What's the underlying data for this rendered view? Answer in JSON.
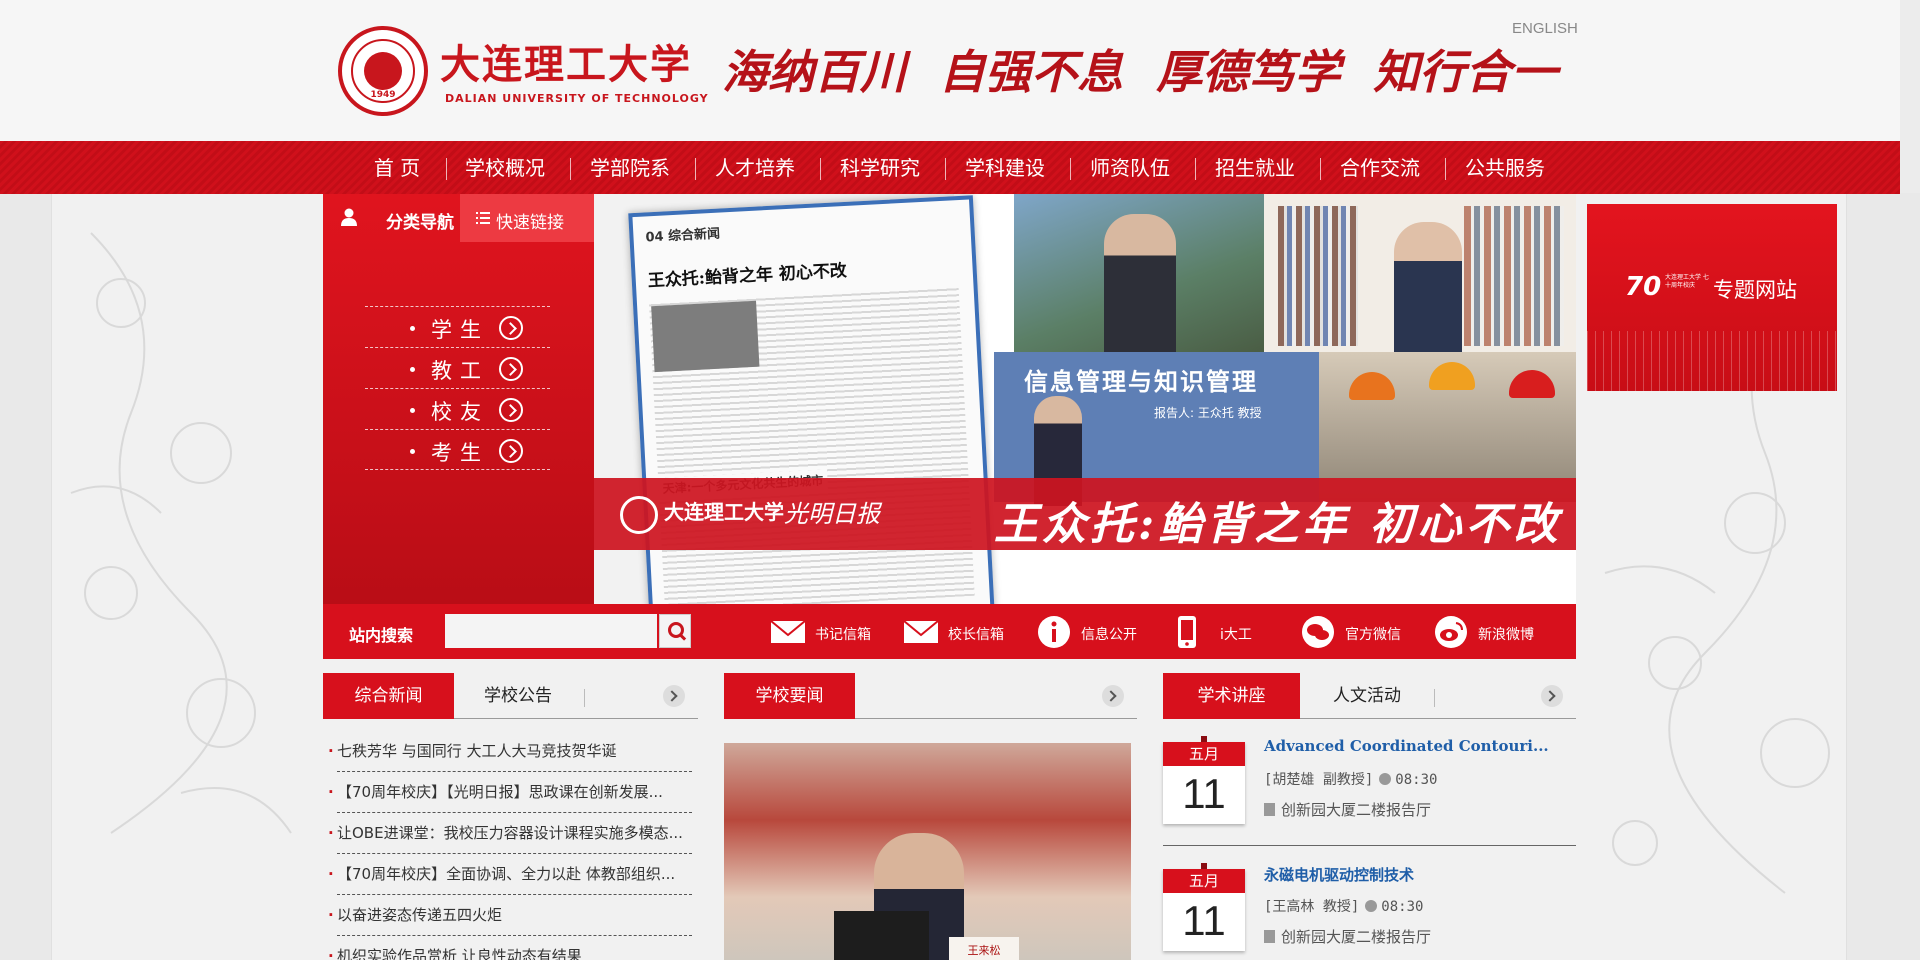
{
  "header": {
    "logo_cn": "大连理工大学",
    "logo_en": "DALIAN UNIVERSITY OF TECHNOLOGY",
    "logo_seal_year": "1949",
    "motto": [
      "海纳百川",
      "自强不息",
      "厚德笃学",
      "知行合一"
    ],
    "english_link": "ENGLISH"
  },
  "nav": {
    "items": [
      "首 页",
      "学校概况",
      "学部院系",
      "人才培养",
      "科学研究",
      "学科建设",
      "师资队伍",
      "招生就业",
      "合作交流",
      "公共服务"
    ]
  },
  "left_panel": {
    "tab_category": "分类导航",
    "tab_quick": "快速链接",
    "categories": [
      "学生",
      "教工",
      "校友",
      "考生"
    ]
  },
  "banner": {
    "paper_section": "04 综合新闻",
    "paper_title": "王众托:鲐背之年  初心不改",
    "paper_subtitle": "天津:一个多元文化共生的城市",
    "slide_text": "信息管理与知识管理",
    "slide_sub": "报告人: 王众托 教授",
    "strip_logo": "大连理工大学",
    "strip_paper": "光明日报",
    "strip_headline": "王众托:鲐背之年 初心不改"
  },
  "side_ad": {
    "seventy": "70",
    "mini_text": "大连理工大学 七十周年校庆",
    "topic": "专题网站"
  },
  "search": {
    "label": "站内搜索",
    "placeholder": "",
    "quick_links": [
      {
        "icon": "mail-icon",
        "label": "书记信箱"
      },
      {
        "icon": "mail-icon",
        "label": "校长信箱"
      },
      {
        "icon": "info-icon",
        "label": "信息公开"
      },
      {
        "icon": "phone-icon",
        "label": "i大工"
      },
      {
        "icon": "wechat-icon",
        "label": "官方微信"
      },
      {
        "icon": "weibo-icon",
        "label": "新浪微博"
      }
    ]
  },
  "news": {
    "tab_active": "综合新闻",
    "tab_other": "学校公告",
    "items": [
      "七秩芳华 与国同行 大工人大马竞技贺华诞",
      "【70周年校庆】【光明日报】思政课在创新发展...",
      "让OBE进课堂：我校压力容器设计课程实施多模态...",
      "【70周年校庆】全面协调、全力以赴 体教部组织...",
      "以奋进姿态传递五四火炬",
      "机织实验作品赏析 让良性动态有结果"
    ]
  },
  "headlines": {
    "tab_active": "学校要闻",
    "photo_nameplate": "王来松"
  },
  "lectures": {
    "tab_active": "学术讲座",
    "tab_other": "人文活动",
    "items": [
      {
        "month": "五月",
        "day": "11",
        "title": "Advanced Coordinated Contouri...",
        "speaker": "[胡楚雄 副教授]",
        "time": "08:30",
        "place": "创新园大厦二楼报告厅"
      },
      {
        "month": "五月",
        "day": "11",
        "title": "永磁电机驱动控制技术",
        "speaker": "[王高林 教授]",
        "time": "08:30",
        "place": "创新园大厦二楼报告厅"
      }
    ]
  },
  "colors": {
    "brand_red": "#d7101c",
    "link_blue": "#1f5ea8"
  }
}
